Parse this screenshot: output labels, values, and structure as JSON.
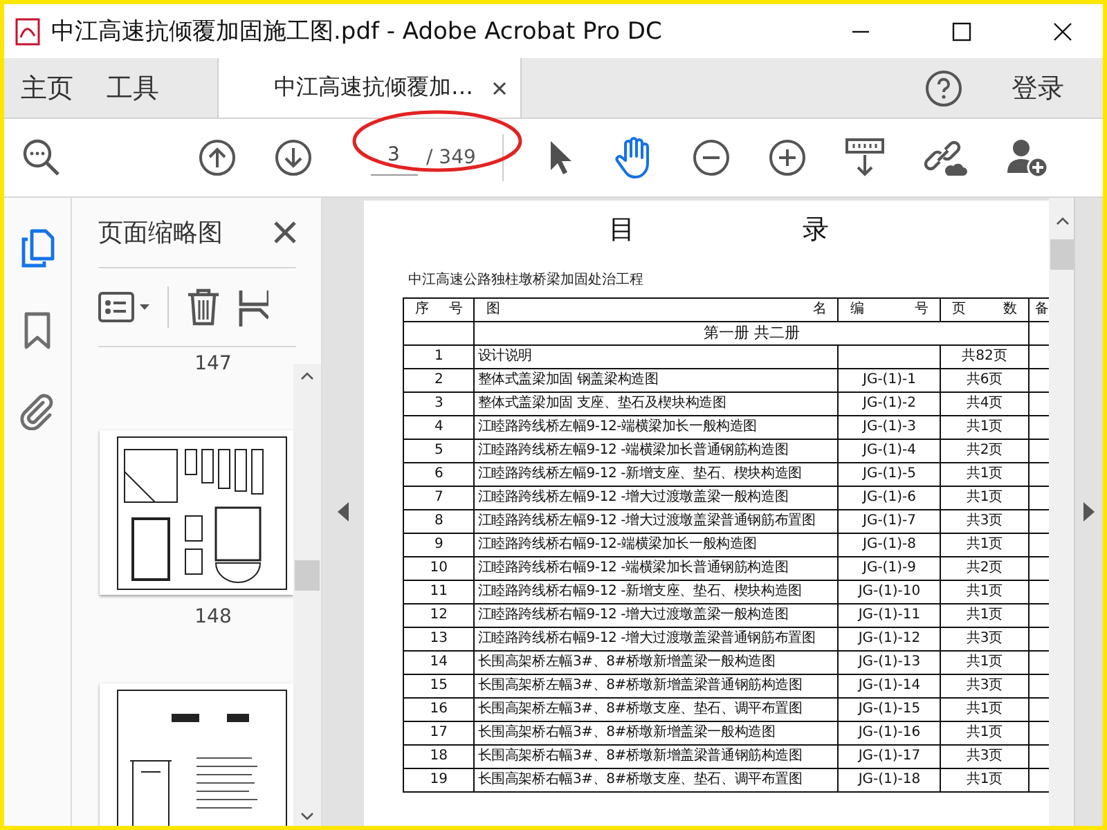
{
  "window": {
    "title": "中江高速抗倾覆加固施工图.pdf - Adobe Acrobat Pro DC"
  },
  "tabs": [
    {
      "label": "主页",
      "kind": "nav",
      "selected": false
    },
    {
      "label": "工具",
      "kind": "nav",
      "selected": false
    },
    {
      "label": "中江高速抗倾覆加…",
      "kind": "document",
      "selected": true
    }
  ],
  "sign_in": "登录",
  "toolbar": {
    "page_number": "3",
    "page_total": "/ 349",
    "tools": [
      {
        "kind": "select",
        "selected": false
      },
      {
        "kind": "hand",
        "selected": true
      }
    ]
  },
  "sidebar": {
    "rail": [
      {
        "kind": "pages",
        "selected": true
      },
      {
        "kind": "bookmarks",
        "selected": false
      },
      {
        "kind": "attachments",
        "selected": false
      }
    ],
    "panel_title": "页面缩略图",
    "thumbnail_labels": [
      "147",
      "148"
    ]
  },
  "document": {
    "heading": "目 录",
    "project": "中江高速公路独柱墩桥梁加固处治工程",
    "table": {
      "columns": [
        "序 号",
        "图 名",
        "编 号",
        "页 数",
        "备"
      ],
      "section": "第一册 共二册",
      "rows": [
        {
          "no": "1",
          "name": "设计说明",
          "pages": "共82页"
        },
        {
          "no": "2",
          "name": "整体式盖梁加固 钢盖梁构造图",
          "code": "JG-(1)-1",
          "pages": "共6页"
        },
        {
          "no": "3",
          "name": "整体式盖梁加固 支座、垫石及楔块构造图",
          "code": "JG-(1)-2",
          "pages": "共4页"
        },
        {
          "no": "4",
          "name": "江睦路跨线桥左幅9-12-端横梁加长一般构造图",
          "code": "JG-(1)-3",
          "pages": "共1页"
        },
        {
          "no": "5",
          "name": "江睦路跨线桥左幅9-12 -端横梁加长普通钢筋构造图",
          "code": "JG-(1)-4",
          "pages": "共2页"
        },
        {
          "no": "6",
          "name": "江睦路跨线桥左幅9-12 -新增支座、垫石、楔块构造图",
          "code": "JG-(1)-5",
          "pages": "共1页"
        },
        {
          "no": "7",
          "name": "江睦路跨线桥左幅9-12 -增大过渡墩盖梁一般构造图",
          "code": "JG-(1)-6",
          "pages": "共1页"
        },
        {
          "no": "8",
          "name": "江睦路跨线桥左幅9-12 -增大过渡墩盖梁普通钢筋布置图",
          "code": "JG-(1)-7",
          "pages": "共3页"
        },
        {
          "no": "9",
          "name": "江睦路跨线桥右幅9-12-端横梁加长一般构造图",
          "code": "JG-(1)-8",
          "pages": "共1页"
        },
        {
          "no": "10",
          "name": "江睦路跨线桥右幅9-12 -端横梁加长普通钢筋构造图",
          "code": "JG-(1)-9",
          "pages": "共2页"
        },
        {
          "no": "11",
          "name": "江睦路跨线桥右幅9-12 -新增支座、垫石、楔块构造图",
          "code": "JG-(1)-10",
          "pages": "共1页"
        },
        {
          "no": "12",
          "name": "江睦路跨线桥右幅9-12 -增大过渡墩盖梁一般构造图",
          "code": "JG-(1)-11",
          "pages": "共1页"
        },
        {
          "no": "13",
          "name": "江睦路跨线桥右幅9-12 -增大过渡墩盖梁普通钢筋布置图",
          "code": "JG-(1)-12",
          "pages": "共3页"
        },
        {
          "no": "14",
          "name": "长围高架桥左幅3#、8#桥墩新增盖梁一般构造图",
          "code": "JG-(1)-13",
          "pages": "共1页"
        },
        {
          "no": "15",
          "name": "长围高架桥左幅3#、8#桥墩新增盖梁普通钢筋构造图",
          "code": "JG-(1)-14",
          "pages": "共3页"
        },
        {
          "no": "16",
          "name": "长围高架桥左幅3#、8#桥墩支座、垫石、调平布置图",
          "code": "JG-(1)-15",
          "pages": "共1页"
        },
        {
          "no": "17",
          "name": "长围高架桥右幅3#、8#桥墩新增盖梁一般构造图",
          "code": "JG-(1)-16",
          "pages": "共1页"
        },
        {
          "no": "18",
          "name": "长围高架桥右幅3#、8#桥墩新增盖梁普通钢筋构造图",
          "code": "JG-(1)-17",
          "pages": "共3页"
        },
        {
          "no": "19",
          "name": "长围高架桥右幅3#、8#桥墩支座、垫石、调平布置图",
          "code": "JG-(1)-18",
          "pages": "共1页"
        }
      ]
    }
  }
}
